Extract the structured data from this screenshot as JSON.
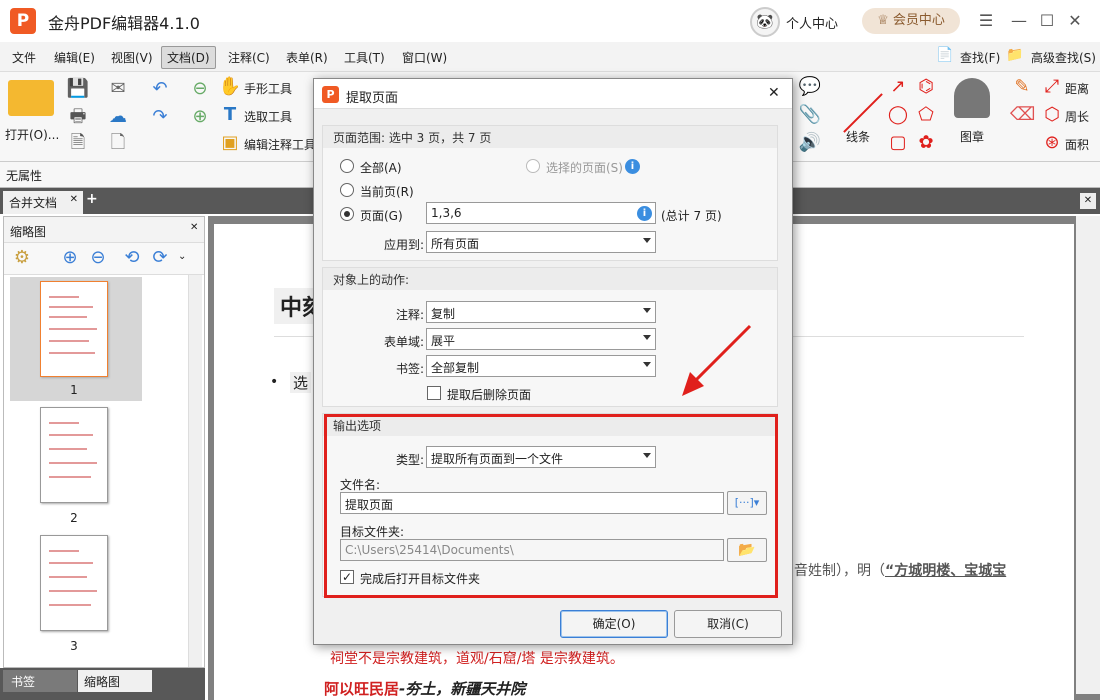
{
  "app": {
    "logo": "P",
    "title": "金舟PDF编辑器4.1.0",
    "personal": "个人中心",
    "vip": "会员中心",
    "avatar": "🐼"
  },
  "window": {
    "menu": "☰",
    "minimize": "—",
    "maximize": "☐",
    "close": "✕"
  },
  "menubar": {
    "items": [
      "文件",
      "编辑(E)",
      "视图(V)",
      "文档(D)",
      "注释(C)",
      "表单(R)",
      "工具(T)",
      "窗口(W)"
    ],
    "find": "查找(F)",
    "advanced_find": "高级查找(S)"
  },
  "toolbar": {
    "open": "打开(O)...",
    "hand": "手形工具",
    "select": "选取工具",
    "edit_annot": "编辑注释工具",
    "lines": "线条",
    "stamp": "图章",
    "distance": "距离",
    "perimeter": "周长",
    "area": "面积"
  },
  "propbar": {
    "label": "无属性"
  },
  "tabs": {
    "doc": "合并文档",
    "add": "+",
    "close": "✕"
  },
  "leftpanel": {
    "title": "缩略图",
    "close": "✕",
    "thumbs": [
      "1",
      "2",
      "3"
    ],
    "bottom_tabs": [
      "书签",
      "缩略图"
    ]
  },
  "doc": {
    "heading_frag": "中刻",
    "bullet_frag": "选",
    "right_text": "音姓制），明（",
    "right_bold": "“方城明楼、宝城宝",
    "red_line": "祠堂不是宗教建筑，道观/石窟/塔 是宗教建筑。",
    "bottom_bold": "阿以旺民居",
    "bottom_italic": "-夯土，新疆天井院"
  },
  "dialog": {
    "title": "提取页面",
    "close": "✕",
    "range": {
      "header": "页面范围: 选中 3 页，共 7 页",
      "all": "全部(A)",
      "selected": "选择的页面(S)",
      "current": "当前页(R)",
      "pages": "页面(G)",
      "pages_value": "1,3,6",
      "total": "(总计 7 页)",
      "apply_label": "应用到:",
      "apply_value": "所有页面"
    },
    "actions": {
      "header": "对象上的动作:",
      "annot_label": "注释:",
      "annot_value": "复制",
      "form_label": "表单域:",
      "form_value": "展平",
      "bookmark_label": "书签:",
      "bookmark_value": "全部复制",
      "delete_after": "提取后删除页面"
    },
    "output": {
      "header": "输出选项",
      "type_label": "类型:",
      "type_value": "提取所有页面到一个文件",
      "filename_label": "文件名:",
      "filename_value": "提取页面",
      "folder_label": "目标文件夹:",
      "folder_value": "C:\\Users\\25414\\Documents\\",
      "open_after": "完成后打开目标文件夹"
    },
    "ok": "确定(O)",
    "cancel": "取消(C)"
  },
  "colors": {
    "accent": "#f05a24",
    "highlight": "#e0201c"
  }
}
